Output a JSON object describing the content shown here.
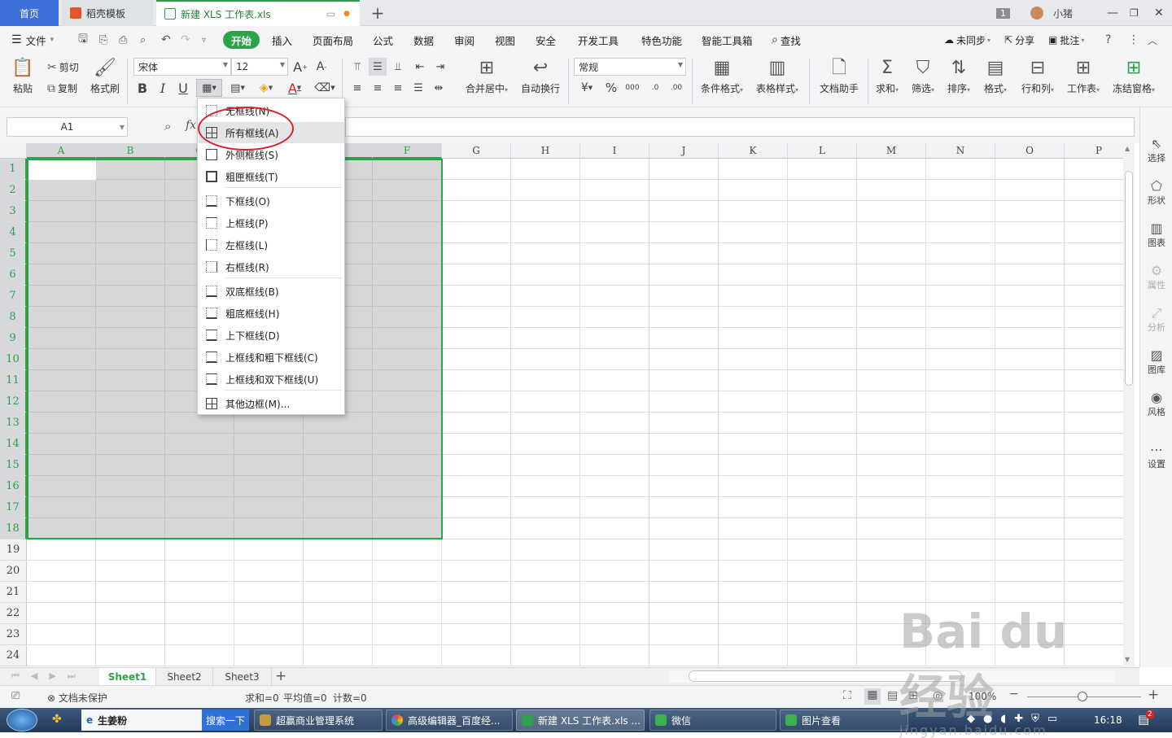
{
  "titlebar": {
    "tabs": [
      {
        "label": "首页"
      },
      {
        "label": "稻壳模板"
      },
      {
        "label": "新建 XLS 工作表.xls"
      }
    ],
    "badge": "1",
    "username": "小猪"
  },
  "menubar": {
    "file": "文件",
    "items": [
      "开始",
      "插入",
      "页面布局",
      "公式",
      "数据",
      "审阅",
      "视图",
      "安全",
      "开发工具",
      "特色功能",
      "智能工具箱"
    ],
    "search": "查找",
    "sync": "未同步",
    "share": "分享",
    "comment": "批注"
  },
  "ribbon": {
    "paste": "粘贴",
    "cut": "剪切",
    "copy": "复制",
    "format_painter": "格式刷",
    "font_name": "宋体",
    "font_size": "12",
    "merge": "合并居中",
    "wrap": "自动换行",
    "number_format": "常规",
    "cond_format": "条件格式",
    "table_style": "表格样式",
    "doc_helper": "文档助手",
    "sum": "求和",
    "filter": "筛选",
    "sort": "排序",
    "format": "格式",
    "row_col": "行和列",
    "worksheet": "工作表",
    "freeze": "冻结窗格"
  },
  "formula": {
    "cell_ref": "A1",
    "fx": "fx"
  },
  "grid": {
    "columns": [
      "A",
      "B",
      "C",
      "D",
      "E",
      "F",
      "G",
      "H",
      "I",
      "J",
      "K",
      "L",
      "M",
      "N",
      "O",
      "P"
    ],
    "rows": [
      "1",
      "2",
      "3",
      "4",
      "5",
      "6",
      "7",
      "8",
      "9",
      "10",
      "11",
      "12",
      "13",
      "14",
      "15",
      "16",
      "17",
      "18",
      "19",
      "20",
      "21",
      "22",
      "23",
      "24"
    ]
  },
  "border_menu": {
    "items": [
      {
        "label": "无框线(N)"
      },
      {
        "label": "所有框线(A)"
      },
      {
        "label": "外侧框线(S)"
      },
      {
        "label": "粗匣框线(T)"
      },
      {
        "label": "下框线(O)"
      },
      {
        "label": "上框线(P)"
      },
      {
        "label": "左框线(L)"
      },
      {
        "label": "右框线(R)"
      },
      {
        "label": "双底框线(B)"
      },
      {
        "label": "粗底框线(H)"
      },
      {
        "label": "上下框线(D)"
      },
      {
        "label": "上框线和粗下框线(C)"
      },
      {
        "label": "上框线和双下框线(U)"
      },
      {
        "label": "其他边框(M)..."
      }
    ],
    "highlighted": "所有框线(A)"
  },
  "side_panel": [
    {
      "label": "选择",
      "enabled": true
    },
    {
      "label": "形状",
      "enabled": true
    },
    {
      "label": "图表",
      "enabled": true
    },
    {
      "label": "属性",
      "enabled": false
    },
    {
      "label": "分析",
      "enabled": false
    },
    {
      "label": "图库",
      "enabled": true
    },
    {
      "label": "风格",
      "enabled": true
    },
    {
      "label": "设置",
      "enabled": true
    }
  ],
  "sheets": [
    {
      "label": "Sheet1",
      "active": true
    },
    {
      "label": "Sheet2",
      "active": false
    },
    {
      "label": "Sheet3",
      "active": false
    }
  ],
  "statusbar": {
    "protect": "文档未保护",
    "sum": "求和=0",
    "avg": "平均值=0",
    "count": "计数=0",
    "zoom": "100%"
  },
  "taskbar": {
    "quick": "生姜粉",
    "search": "搜索一下",
    "items": [
      "超赢商业管理系统",
      "高级编辑器_百度经...",
      "新建 XLS 工作表.xls ...",
      "微信",
      "图片查看"
    ],
    "time": "16:18",
    "notif": "2"
  },
  "watermark": "Bai du 经验",
  "watermark_url": "jingyan.baidu.com",
  "colors": {
    "accent": "#2ea24a",
    "home_tab": "#3d6fd8",
    "highlight_circle": "#d9232a"
  }
}
